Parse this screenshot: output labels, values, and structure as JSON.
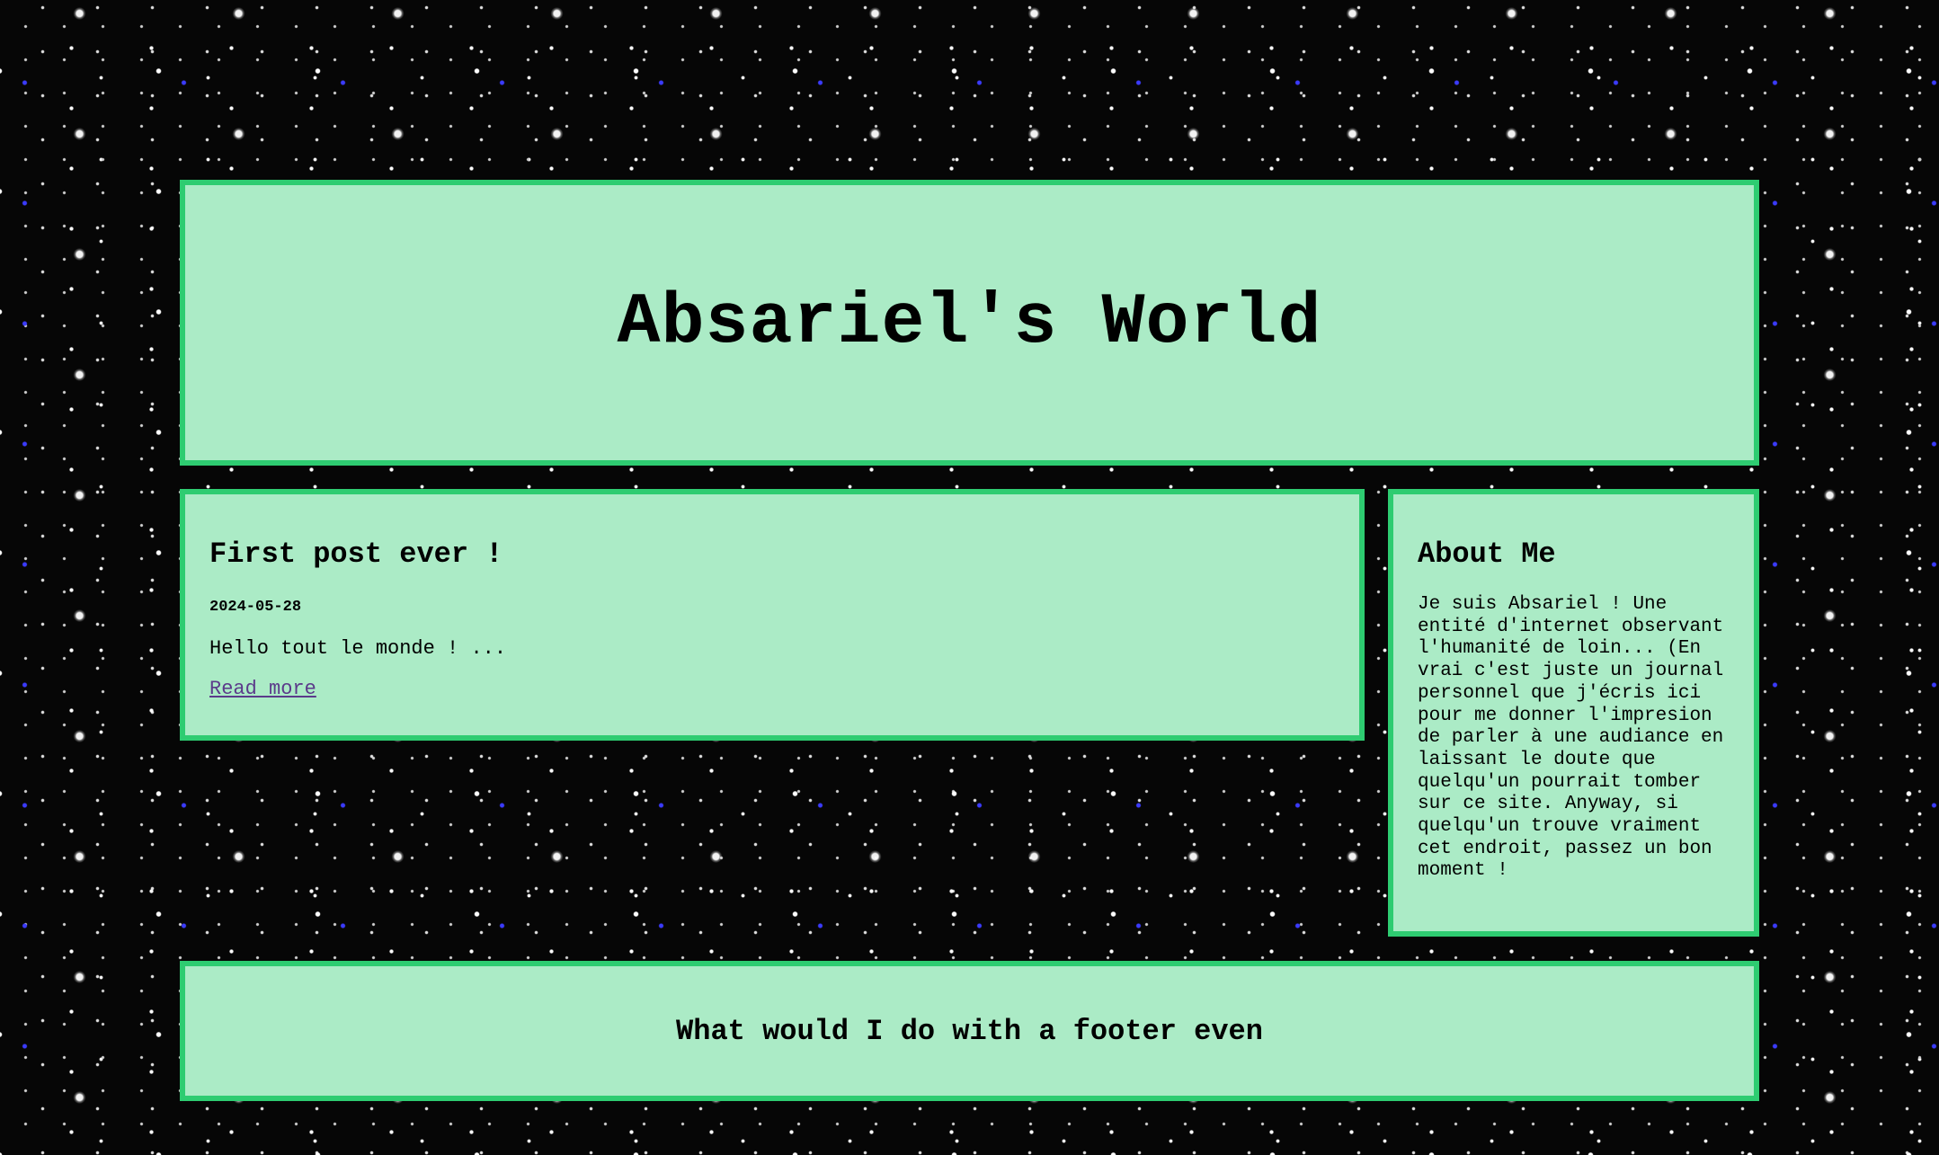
{
  "header": {
    "title": "Absariel's World"
  },
  "posts": [
    {
      "title": "First post ever !",
      "date": "2024-05-28",
      "excerpt": "Hello tout le monde ! ...",
      "read_more_label": "Read more"
    }
  ],
  "about": {
    "title": "About Me",
    "text": "Je suis Absariel ! Une entité d'internet observant l'humanité de loin... (En vrai c'est juste un journal personnel que j'écris ici pour me donner l'impresion de parler à une audiance en laissant le doute que quelqu'un pourrait tomber sur ce site. Anyway, si quelqu'un trouve vraiment cet endroit, passez un bon moment !"
  },
  "footer": {
    "text": "What would I do with a footer even"
  },
  "colors": {
    "panel_background": "#abebc6",
    "panel_border": "#2ecc71",
    "page_background": "#060606",
    "link": "#5b3a8a"
  }
}
